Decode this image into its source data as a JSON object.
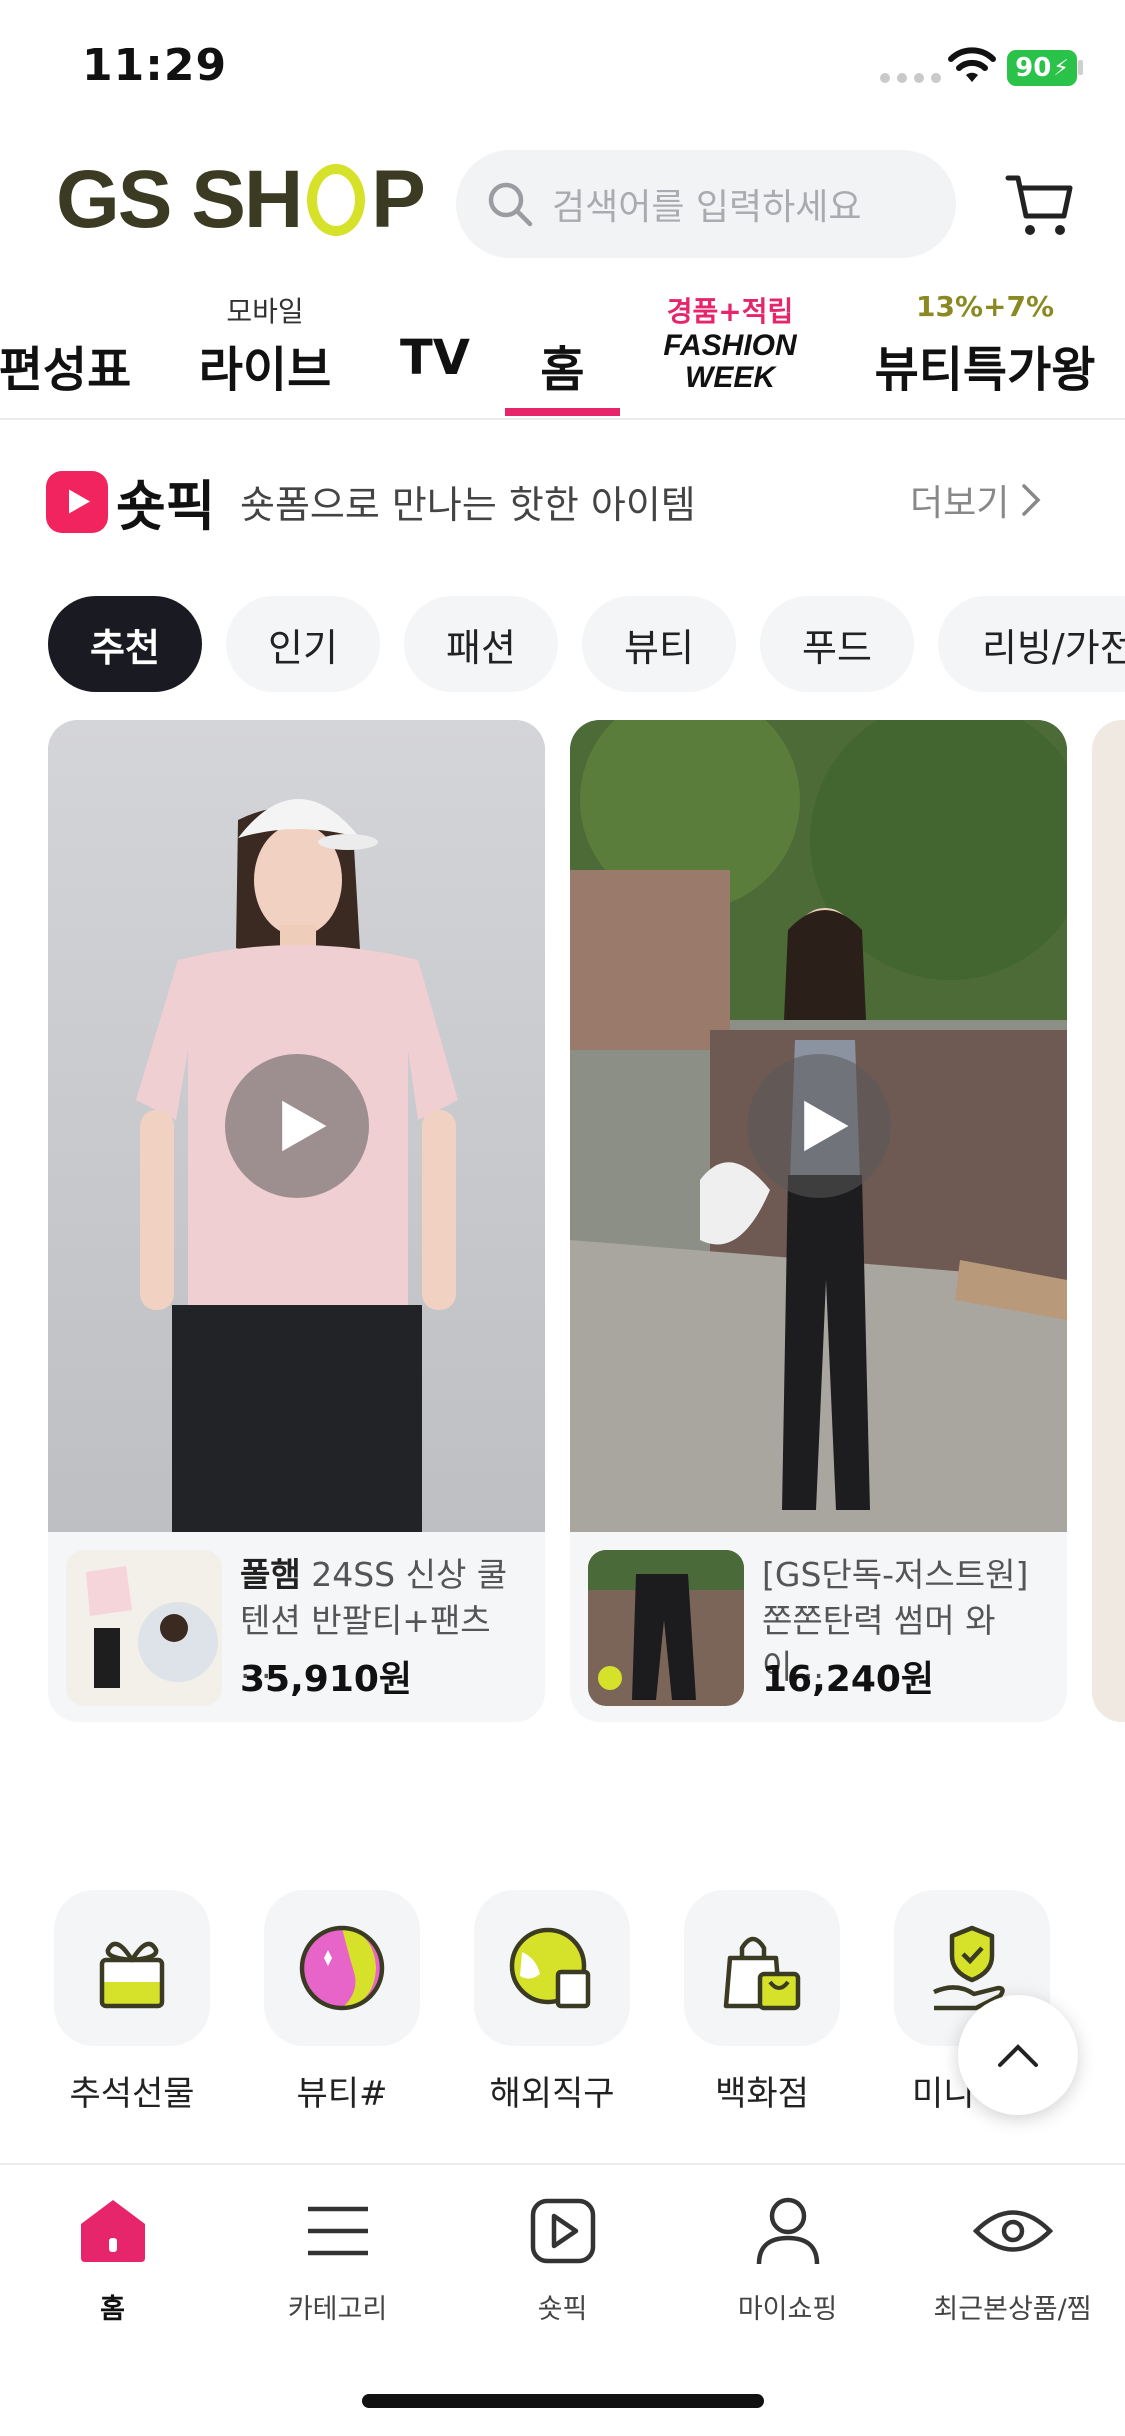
{
  "status_bar": {
    "time": "11:29",
    "battery": "90"
  },
  "header": {
    "logo": {
      "left": "GS SH",
      "right": "P"
    },
    "search_placeholder": "검색어를 입력하세요",
    "icons": [
      "search-icon",
      "cart-icon"
    ]
  },
  "top_nav": [
    {
      "sub": "",
      "label": "편성표"
    },
    {
      "sub": "모바일",
      "label": "라이브"
    },
    {
      "sub": "",
      "label": "TV"
    },
    {
      "sub": "",
      "label": "홈",
      "active": true
    },
    {
      "sub": "경품+적립",
      "label": "FASHION WEEK"
    },
    {
      "sub": "13%+7%",
      "label": "뷰티특가왕"
    }
  ],
  "shopick": {
    "title": "숏픽",
    "description": "숏폼으로 만나는 핫한 아이템",
    "more": "더보기"
  },
  "chips": [
    "추천",
    "인기",
    "패션",
    "뷰티",
    "푸드",
    "리빙/가전"
  ],
  "active_chip": "추천",
  "cards": [
    {
      "brand": "폴햄",
      "name": " 24SS 신상 쿨텐션 반팔티+팬츠 ...",
      "price": "35,910원"
    },
    {
      "brand": "",
      "name": "[GS단독-저스트원] 쫀쫀탄력 썸머 와이...",
      "price": "16,240원"
    }
  ],
  "categories": [
    {
      "label": "추석선물",
      "icon": "gift-icon"
    },
    {
      "label": "뷰티#",
      "icon": "beauty-icon"
    },
    {
      "label": "해외직구",
      "icon": "globe-icon"
    },
    {
      "label": "백화점",
      "icon": "shopping-bag-icon"
    },
    {
      "label": "미니",
      "icon": "shield-hand-icon"
    }
  ],
  "bottom_tabs": [
    {
      "label": "홈",
      "icon": "home-icon",
      "active": true
    },
    {
      "label": "카테고리",
      "icon": "menu-icon"
    },
    {
      "label": "숏픽",
      "icon": "play-icon"
    },
    {
      "label": "마이쇼핑",
      "icon": "user-icon"
    },
    {
      "label": "최근본상품/찜",
      "icon": "eye-icon"
    }
  ],
  "colors": {
    "accent": "#e6256b",
    "brand_lime": "#d6e22a",
    "brand_olive": "#3b3b23",
    "chip_active": "#1a1b22"
  }
}
